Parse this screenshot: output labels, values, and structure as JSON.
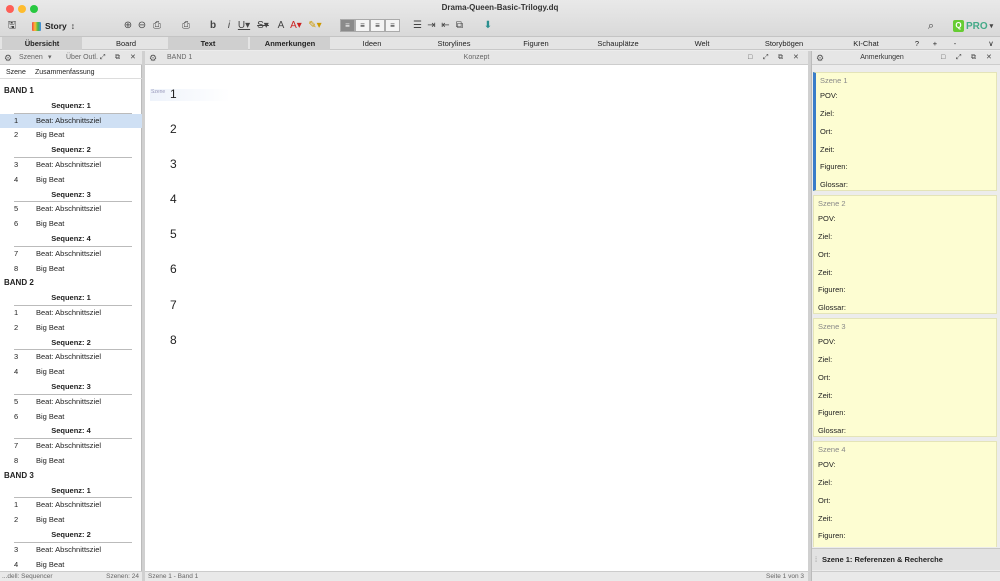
{
  "window": {
    "title": "Drama-Queen-Basic-Trilogy.dq"
  },
  "toolbar": {
    "story_label": "Story",
    "icons": [
      "save-icon",
      "zoom-in-icon",
      "zoom-out-icon",
      "attach-icon",
      "print-icon",
      "bold-icon",
      "italic-icon",
      "underline-icon",
      "strikethrough-icon",
      "font-icon",
      "font-color-icon",
      "highlight-icon",
      "align-left-icon",
      "align-center-icon",
      "align-right-icon",
      "justify-icon",
      "list-icon",
      "indent-icon",
      "outdent-icon",
      "insert-icon",
      "search-icon"
    ],
    "pro_label": "PRO"
  },
  "tabs": [
    {
      "label": "Übersicht",
      "active": true
    },
    {
      "label": "Board",
      "active": false
    },
    {
      "label": "Text",
      "active": true
    },
    {
      "label": "Anmerkungen",
      "active": true
    },
    {
      "label": "Ideen",
      "active": false
    },
    {
      "label": "Storylines",
      "active": false
    },
    {
      "label": "Figuren",
      "active": false
    },
    {
      "label": "Schauplätze",
      "active": false
    },
    {
      "label": "Welt",
      "active": false
    },
    {
      "label": "Storybögen",
      "active": false
    },
    {
      "label": "KI-Chat",
      "active": false
    },
    {
      "label": "?",
      "active": false
    },
    {
      "label": "+",
      "active": false
    },
    {
      "label": "-",
      "active": false
    }
  ],
  "left_panel": {
    "mode": "Szenen",
    "view": "Über Outl.",
    "col_scene": "Szene",
    "col_summary": "Zusammenfassung",
    "bands": [
      {
        "title": "BAND 1",
        "sequences": [
          {
            "title": "Sequenz: 1",
            "rows": [
              {
                "num": "1",
                "text": "Beat: Abschnittsziel",
                "selected": true
              },
              {
                "num": "2",
                "text": "Big Beat"
              }
            ]
          },
          {
            "title": "Sequenz: 2",
            "rows": [
              {
                "num": "3",
                "text": "Beat: Abschnittsziel"
              },
              {
                "num": "4",
                "text": "Big Beat"
              }
            ]
          },
          {
            "title": "Sequenz: 3",
            "rows": [
              {
                "num": "5",
                "text": "Beat: Abschnittsziel"
              },
              {
                "num": "6",
                "text": "Big Beat"
              }
            ]
          },
          {
            "title": "Sequenz: 4",
            "rows": [
              {
                "num": "7",
                "text": "Beat: Abschnittsziel"
              },
              {
                "num": "8",
                "text": "Big Beat"
              }
            ]
          }
        ]
      },
      {
        "title": "BAND 2",
        "sequences": [
          {
            "title": "Sequenz: 1",
            "rows": [
              {
                "num": "1",
                "text": "Beat: Abschnittsziel"
              },
              {
                "num": "2",
                "text": "Big Beat"
              }
            ]
          },
          {
            "title": "Sequenz: 2",
            "rows": [
              {
                "num": "3",
                "text": "Beat: Abschnittsziel"
              },
              {
                "num": "4",
                "text": "Big Beat"
              }
            ]
          },
          {
            "title": "Sequenz: 3",
            "rows": [
              {
                "num": "5",
                "text": "Beat: Abschnittsziel"
              },
              {
                "num": "6",
                "text": "Big Beat"
              }
            ]
          },
          {
            "title": "Sequenz: 4",
            "rows": [
              {
                "num": "7",
                "text": "Beat: Abschnittsziel"
              },
              {
                "num": "8",
                "text": "Big Beat"
              }
            ]
          }
        ]
      },
      {
        "title": "BAND 3",
        "sequences": [
          {
            "title": "Sequenz: 1",
            "rows": [
              {
                "num": "1",
                "text": "Beat: Abschnittsziel"
              },
              {
                "num": "2",
                "text": "Big Beat"
              }
            ]
          },
          {
            "title": "Sequenz: 2",
            "rows": [
              {
                "num": "3",
                "text": "Beat: Abschnittsziel"
              },
              {
                "num": "4",
                "text": "Big Beat"
              }
            ]
          }
        ]
      }
    ],
    "status_left": "...dell: Sequencer",
    "status_right": "Szenen: 24"
  },
  "center_panel": {
    "header_left": "BAND 1",
    "header_title": "Konzept",
    "scene_tag": "Szene",
    "scene_numbers": [
      "1",
      "2",
      "3",
      "4",
      "5",
      "6",
      "7",
      "8"
    ],
    "status_left": "Szene 1 - Band 1",
    "status_right": "Seite 1 von 3"
  },
  "right_panel": {
    "header_title": "Anmerkungen",
    "cards": [
      {
        "title": "Szene 1",
        "fields": [
          "POV:",
          "Ziel:",
          "Ort:",
          "Zeit:",
          "Figuren:",
          "Glossar:"
        ]
      },
      {
        "title": "Szene 2",
        "fields": [
          "POV:",
          "Ziel:",
          "Ort:",
          "Zeit:",
          "Figuren:",
          "Glossar:"
        ]
      },
      {
        "title": "Szene 3",
        "fields": [
          "POV:",
          "Ziel:",
          "Ort:",
          "Zeit:",
          "Figuren:",
          "Glossar:"
        ]
      },
      {
        "title": "Szene 4",
        "fields": [
          "POV:",
          "Ziel:",
          "Ort:",
          "Zeit:",
          "Figuren:"
        ]
      }
    ],
    "reference_bar": "Szene 1: Referenzen & Recherche"
  }
}
